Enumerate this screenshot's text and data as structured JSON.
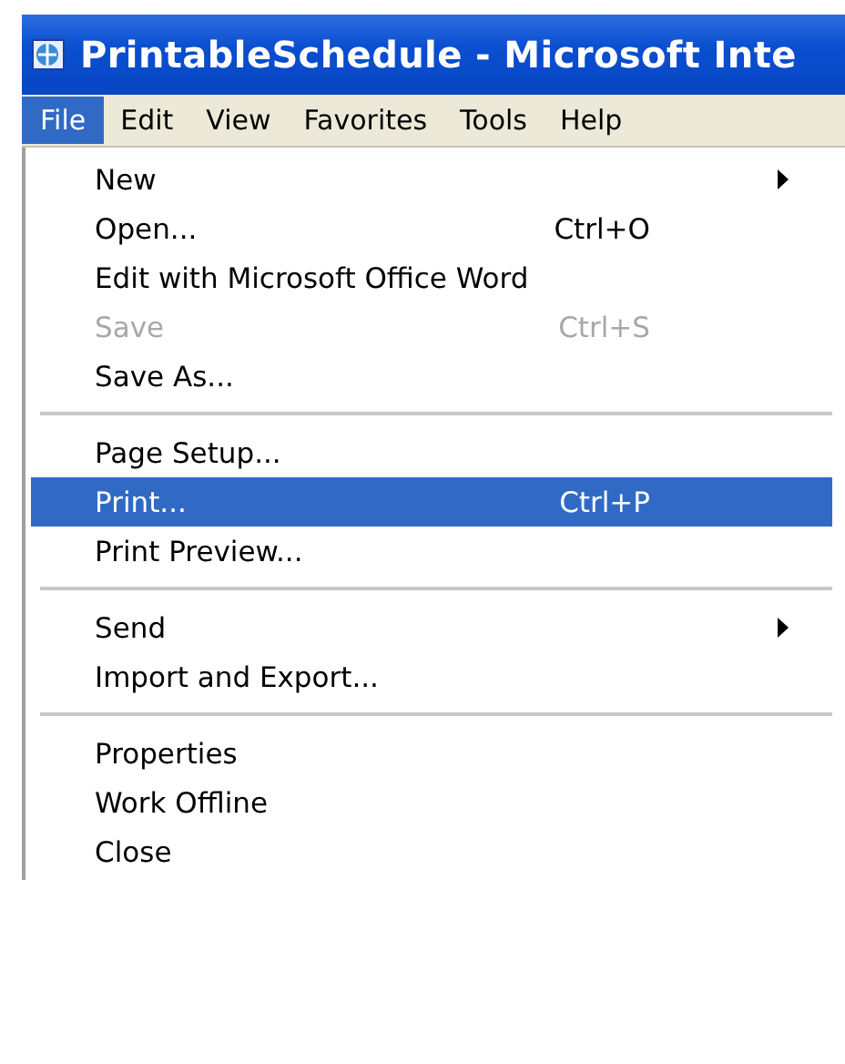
{
  "window": {
    "title": "PrintableSchedule - Microsoft Inte"
  },
  "menu_bar": [
    {
      "label": "File",
      "selected": true
    },
    {
      "label": "Edit",
      "selected": false
    },
    {
      "label": "View",
      "selected": false
    },
    {
      "label": "Favorites",
      "selected": false
    },
    {
      "label": "Tools",
      "selected": false
    },
    {
      "label": "Help",
      "selected": false
    }
  ],
  "file_menu": [
    {
      "kind": "item",
      "label": "New",
      "submenu": true,
      "disabled": false,
      "selected": false
    },
    {
      "kind": "item",
      "label": "Open...",
      "shortcut": "Ctrl+O",
      "disabled": false,
      "selected": false
    },
    {
      "kind": "item",
      "label": "Edit with Microsoft Office Word",
      "disabled": false,
      "selected": false
    },
    {
      "kind": "item",
      "label": "Save",
      "shortcut": "Ctrl+S",
      "disabled": true,
      "selected": false
    },
    {
      "kind": "item",
      "label": "Save As...",
      "disabled": false,
      "selected": false
    },
    {
      "kind": "separator"
    },
    {
      "kind": "item",
      "label": "Page Setup...",
      "disabled": false,
      "selected": false
    },
    {
      "kind": "item",
      "label": "Print...",
      "shortcut": "Ctrl+P",
      "disabled": false,
      "selected": true
    },
    {
      "kind": "item",
      "label": "Print Preview...",
      "disabled": false,
      "selected": false
    },
    {
      "kind": "separator"
    },
    {
      "kind": "item",
      "label": "Send",
      "submenu": true,
      "disabled": false,
      "selected": false
    },
    {
      "kind": "item",
      "label": "Import and Export...",
      "disabled": false,
      "selected": false
    },
    {
      "kind": "separator"
    },
    {
      "kind": "item",
      "label": "Properties",
      "disabled": false,
      "selected": false
    },
    {
      "kind": "item",
      "label": "Work Offline",
      "disabled": false,
      "selected": false
    },
    {
      "kind": "item",
      "label": "Close",
      "disabled": false,
      "selected": false
    }
  ]
}
